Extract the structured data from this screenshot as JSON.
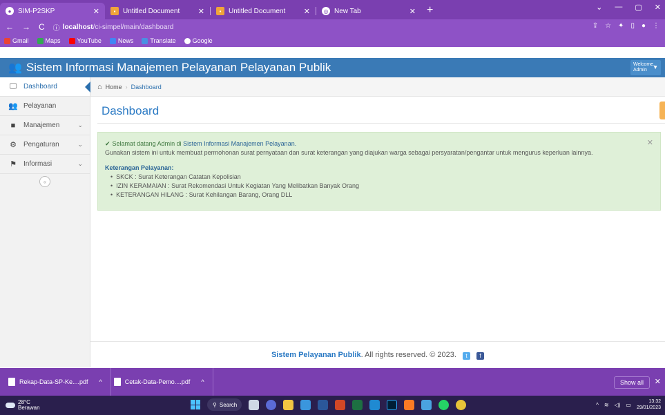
{
  "browser": {
    "tabs": [
      {
        "title": "SIM-P2SKP",
        "active": true
      },
      {
        "title": "Untitled Document",
        "active": false
      },
      {
        "title": "Untitled Document",
        "active": false
      },
      {
        "title": "New Tab",
        "active": false
      }
    ],
    "url_host": "localhost",
    "url_path": "/ci-simpel/main/dashboard",
    "bookmarks": [
      "Gmail",
      "Maps",
      "YouTube",
      "News",
      "Translate",
      "Google"
    ]
  },
  "app": {
    "brand": "Sistem Informasi Manajemen Pelayanan Pelayanan Publik",
    "user_line1": "Welcome,",
    "user_line2": "Admin"
  },
  "sidebar": {
    "items": [
      {
        "label": "Dashboard",
        "icon": "monitor-icon"
      },
      {
        "label": "Pelayanan",
        "icon": "users-icon"
      },
      {
        "label": "Manajemen",
        "icon": "folder-icon"
      },
      {
        "label": "Pengaturan",
        "icon": "cogs-icon"
      },
      {
        "label": "Informasi",
        "icon": "flag-icon"
      }
    ]
  },
  "breadcrumb": {
    "home": "Home",
    "current": "Dashboard"
  },
  "page": {
    "title": "Dashboard"
  },
  "alert": {
    "welcome_prefix": "Selamat datang Admin di ",
    "welcome_link": "Sistem Informasi Manajemen Pelayanan.",
    "description": "Gunakan sistem ini untuk membuat permohonan surat pernyataan dan surat keterangan yang diajukan warga sebagai persyaratan/pengantar untuk mengurus keperluan lainnya.",
    "heading": "Keterangan Pelayanan:",
    "items": [
      "SKCK : Surat Keterangan Catatan Kepolisian",
      "IZIN KERAMAIAN : Surat Rekomendasi Untuk Kegiatan Yang Melibatkan Banyak Orang",
      "KETERANGAN HILANG : Surat Kehilangan Barang, Orang DLL"
    ]
  },
  "footer": {
    "link": "Sistem Pelayanan Publik",
    "text": ". All rights reserved. © 2023."
  },
  "downloads": {
    "items": [
      "Rekap-Data-SP-Ke....pdf",
      "Cetak-Data-Pemo....pdf"
    ],
    "show_all": "Show all"
  },
  "taskbar": {
    "temp": "28°C",
    "weather": "Berawan",
    "search": "Search",
    "time": "13:32",
    "date": "29/01/2023"
  },
  "colors": {
    "accent": "#3a7ab6",
    "browser": "#8e52c6",
    "alert_bg": "#dff0d8"
  }
}
